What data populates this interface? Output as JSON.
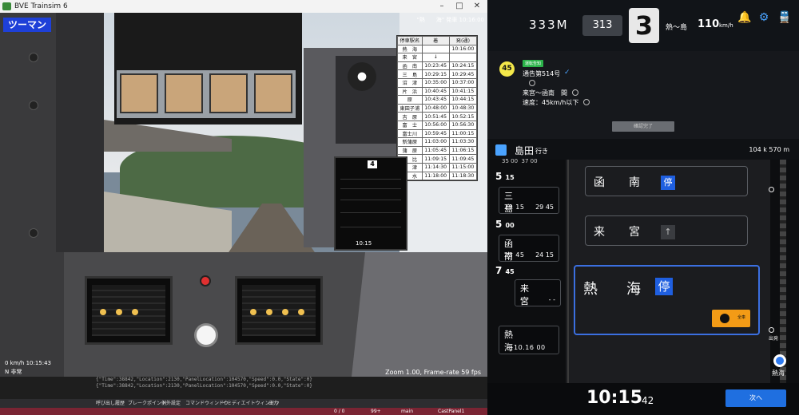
{
  "bve": {
    "window_title": "BVE Trainsim 6",
    "mode_badge": "ツーマン",
    "speed_readout": "0 km/h  10:15:43",
    "status_readout": "N  非常",
    "zoom_readout": "Zoom 1.00, Frame-rate 59 fps",
    "timetable_header": "\"熱　　海\" 発車 10:16:00",
    "timetable": {
      "columns": [
        "停車駅名",
        "着",
        "発(通)"
      ],
      "rows": [
        [
          "熱　海",
          "",
          "10:16:00"
        ],
        [
          "来　宮",
          "↓",
          ""
        ],
        [
          "函　南",
          "10:23:45",
          "10:24:15"
        ],
        [
          "三　島",
          "10:29:15",
          "10:29:45"
        ],
        [
          "沼　津",
          "10:35:00",
          "10:37:00"
        ],
        [
          "片　浜",
          "10:40:45",
          "10:41:15"
        ],
        [
          "原",
          "10:43:45",
          "10:44:15"
        ],
        [
          "東田子浦",
          "10:48:00",
          "10:48:30"
        ],
        [
          "吉　原",
          "10:51:45",
          "10:52:15"
        ],
        [
          "富　士",
          "10:56:00",
          "10:56:30"
        ],
        [
          "富士川",
          "10:59:45",
          "11:00:15"
        ],
        [
          "新蒲原",
          "11:03:00",
          "11:03:30"
        ],
        [
          "蒲　原",
          "11:05:45",
          "11:06:15"
        ],
        [
          "由　比",
          "11:09:15",
          "11:09:45"
        ],
        [
          "興　津",
          "11:14:30",
          "11:15:00"
        ],
        [
          "清　水",
          "11:18:00",
          "11:18:30"
        ]
      ]
    },
    "mini_monitor": {
      "number": "4",
      "time": "10:15"
    },
    "console_lines": [
      "{\"Time\":38842,\"Location\":2130,\"PanelLocation\":104570,\"Speed\":0.0,\"State\":0}",
      "{\"Time\":38842,\"Location\":2130,\"PanelLocation\":104570,\"Speed\":0.0,\"State\":0}"
    ],
    "console_tabs": [
      "呼び出し履歴",
      "ブレークポイント",
      "例外設定",
      "コマンドウィンドウ",
      "イミディエイトウィンドウ",
      "出力"
    ],
    "statusbar": [
      "0 / 0",
      "99+",
      "main",
      "CastPanel1"
    ]
  },
  "panel": {
    "train_number": "333M",
    "car_number": "313",
    "car_count": "3",
    "limit_label": "熱～島",
    "limit_value": "110",
    "limit_unit": "km/h",
    "icons": {
      "bell": "bell-icon",
      "settings": "gear-icon",
      "train": "train-icon"
    },
    "colors": {
      "accent": "#1f6fe0",
      "notice_tag": "#2bb34a",
      "badge": "#f39b16"
    },
    "notice": {
      "number": "45",
      "tag": "運転告知",
      "title": "通告第514号",
      "line1": "来宮～函南　間",
      "line2": "速度：45km/h以下",
      "done_button": "確認完了"
    },
    "destination": {
      "name": "島田",
      "suffix": "行き"
    },
    "distance": "104 k 570 m",
    "timeline": [
      {
        "hour": "5",
        "minute": "15",
        "station": "三　島",
        "arr": "29 15",
        "dep": "29 45"
      },
      {
        "hour": "5",
        "minute": "00",
        "station": "函　南",
        "arr": "23 45",
        "dep": "24 15"
      },
      {
        "hour": "7",
        "minute": "45",
        "station": "来　宮",
        "arr": "- -",
        "dep": "- -"
      },
      {
        "station": "熱　海",
        "dep_full": "10.16 00"
      }
    ],
    "timeline_top_partial": [
      "35 00",
      "37 00"
    ],
    "stations": [
      {
        "name": "函南",
        "mark": "停"
      },
      {
        "name": "来宮",
        "mark": "↑"
      },
      {
        "name": "熱海",
        "mark": "停",
        "badge": "全車"
      }
    ],
    "signal_labels": [
      "",
      "出発"
    ],
    "current_station": "熱海",
    "clock_main": "10:15",
    "clock_sec": "42",
    "next_button": "次へ"
  }
}
